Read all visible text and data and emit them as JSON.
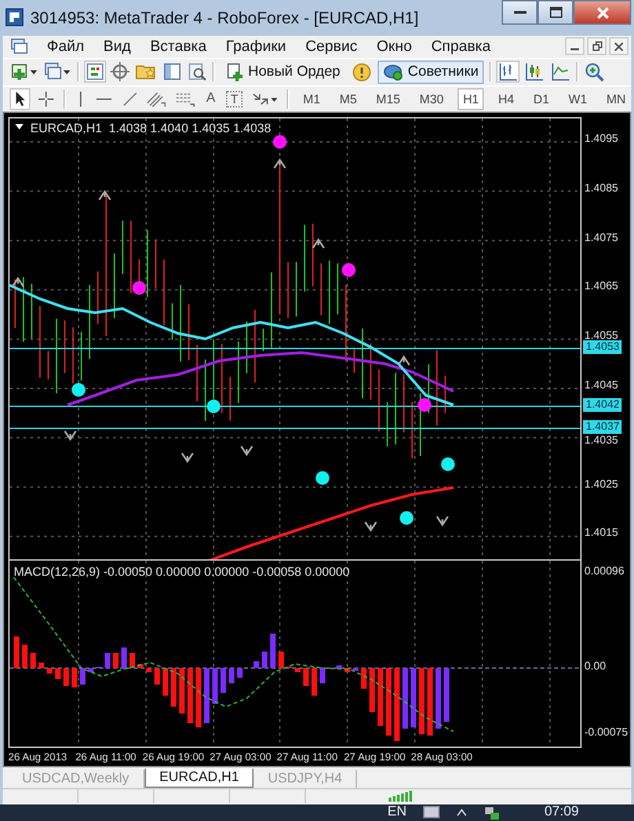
{
  "window": {
    "title": "3014953: MetaTrader 4 - RoboForex - [EURCAD,H1]"
  },
  "menu": [
    "Файл",
    "Вид",
    "Вставка",
    "Графики",
    "Сервис",
    "Окно",
    "Справка"
  ],
  "toolbar": {
    "new_order": "Новый Ордер",
    "experts": {
      "label": "Советники",
      "on": true
    }
  },
  "drawing_tools": {
    "text_tool": "A",
    "label_tool": "T"
  },
  "timeframes": [
    {
      "label": "M1",
      "selected": false
    },
    {
      "label": "M5",
      "selected": false
    },
    {
      "label": "M15",
      "selected": false
    },
    {
      "label": "M30",
      "selected": false
    },
    {
      "label": "H1",
      "selected": true
    },
    {
      "label": "H4",
      "selected": false
    },
    {
      "label": "D1",
      "selected": false
    },
    {
      "label": "W1",
      "selected": false
    },
    {
      "label": "MN",
      "selected": false
    }
  ],
  "chart": {
    "symbol": "EURCAD,H1",
    "ohlc": "1.4038 1.4040 1.4035 1.4038",
    "price_ticks": [
      "1.4095",
      "1.4085",
      "1.4075",
      "1.4065",
      "1.4055",
      "1.4045",
      "1.4035",
      "1.4025",
      "1.4015"
    ],
    "price_markers": [
      "1.4053",
      "1.4042",
      "1.4037"
    ]
  },
  "macd": {
    "label": "MACD(12,26,9) -0.00050 0.00000 0.00000 -0.00058 0.00000",
    "ticks": [
      "0.00096",
      "0.00",
      "-0.00075"
    ]
  },
  "time_axis": [
    "26 Aug 2013",
    "26 Aug 11:00",
    "26 Aug 19:00",
    "27 Aug 03:00",
    "27 Aug 11:00",
    "27 Aug 19:00",
    "28 Aug 03:00"
  ],
  "tabs": [
    {
      "label": "USDCAD,Weekly",
      "selected": false
    },
    {
      "label": "EURCAD,H1",
      "selected": true
    },
    {
      "label": "USDJPY,H4",
      "selected": false
    }
  ],
  "taskbar": {
    "language": "EN",
    "clock": "07:09"
  }
}
